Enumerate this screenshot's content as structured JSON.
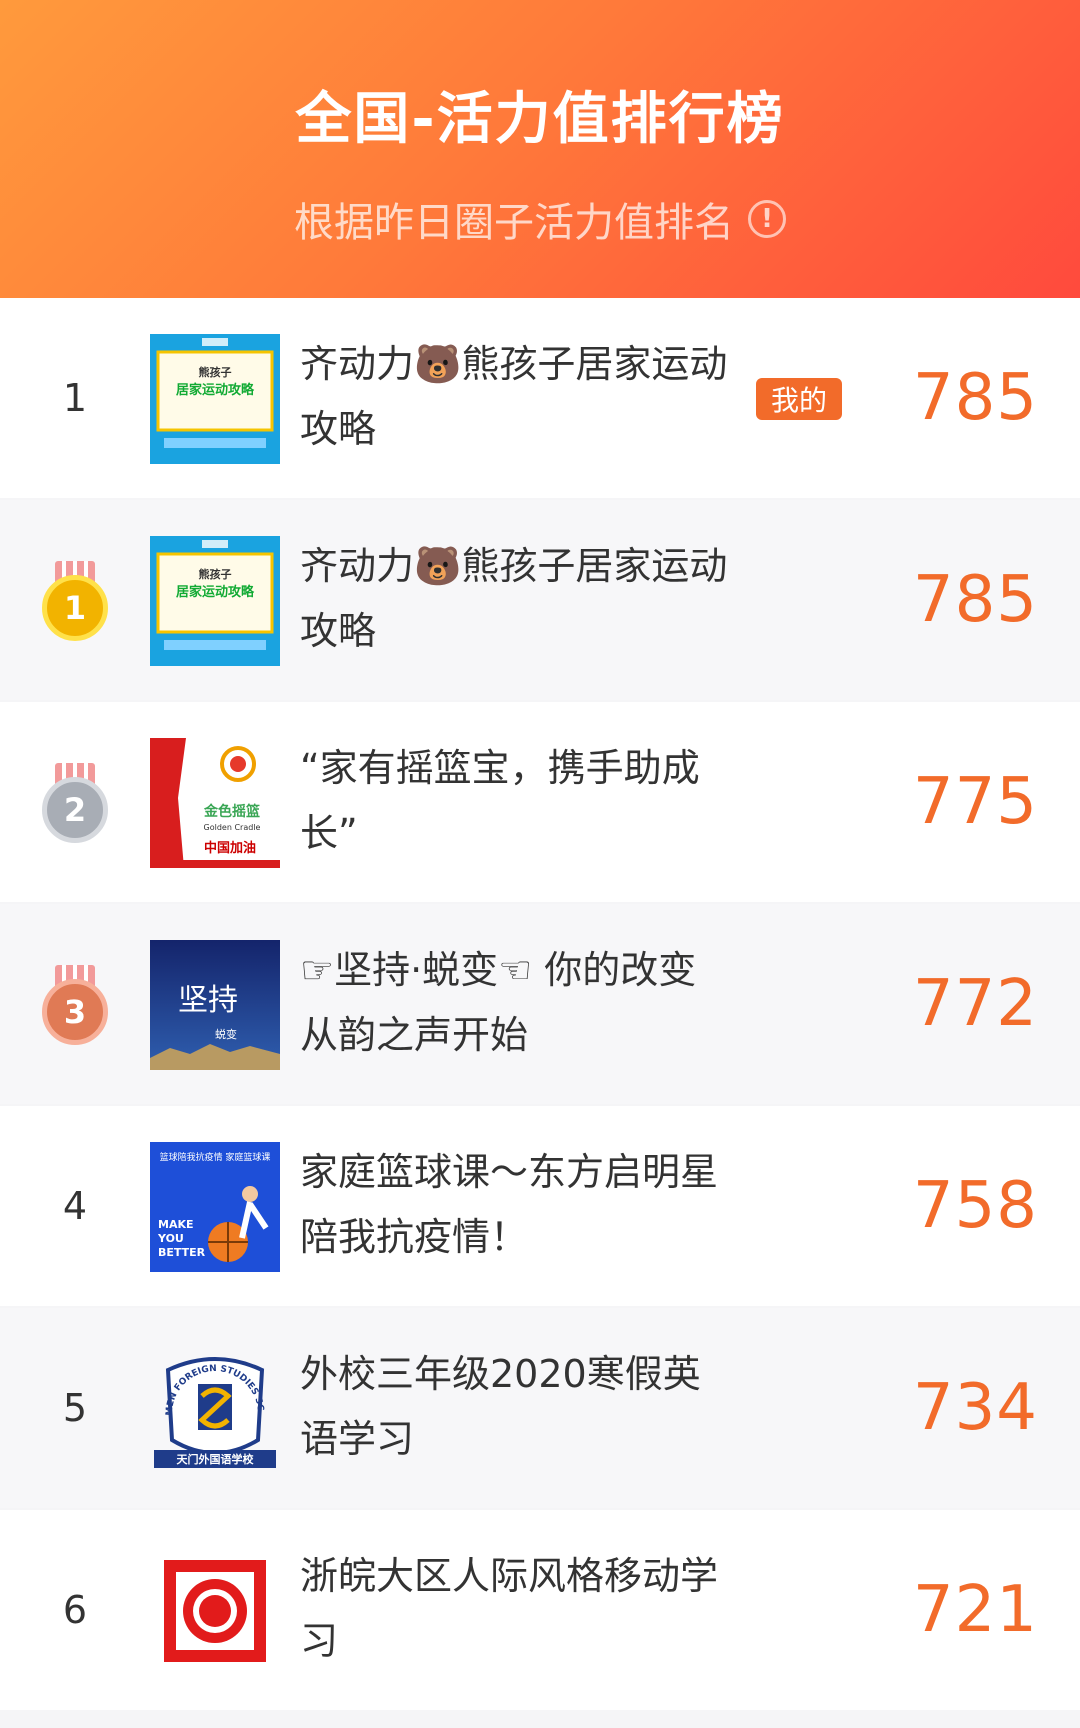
{
  "header": {
    "title": "全国-活力值排行榜",
    "subtitle": "根据昨日圈子活力值排名",
    "info_icon": "info-icon",
    "gradient_colors": [
      "#ff9a3c",
      "#ff4a3d"
    ]
  },
  "mine_badge": "我的",
  "accent_color": "#f26b2a",
  "rows": [
    {
      "rank": "1",
      "name": "齐动力🐻熊孩子居家运动攻略",
      "score": "785"
    },
    {
      "rank": "1",
      "name": "齐动力🐻熊孩子居家运动攻略",
      "score": "785"
    },
    {
      "rank": "2",
      "name": "“家有摇篮宝，携手助成长”",
      "score": "775"
    },
    {
      "rank": "3",
      "name": "☞坚持·蜕变☜ 你的改变从韵之声开始",
      "score": "772"
    },
    {
      "rank": "4",
      "name": "家庭篮球课～东方启明星陪我抗疫情！",
      "score": "758"
    },
    {
      "rank": "5",
      "name": "外校三年级2020寒假英语学习",
      "score": "734"
    },
    {
      "rank": "6",
      "name": "浙皖大区人际风格移动学习",
      "score": "721"
    }
  ],
  "thumbs": {
    "bear": {
      "line1": "熊孩子",
      "line2": "居家运动攻略"
    },
    "cradle": {
      "brand": "金色摇篮",
      "english": "Golden Cradle",
      "slogan": "中国加油"
    },
    "persist": {
      "main": "坚持",
      "sub": "蜕变"
    },
    "basketball": {
      "heading": "篮球陪我抗疫情 家庭篮球课",
      "slogan1": "MAKE",
      "slogan2": "YOU",
      "slogan3": "BETTER"
    },
    "school": {
      "arc": "TIANMEN FOREIGN STUDIES SCHOOL",
      "banner": "天门外国语学校"
    }
  }
}
